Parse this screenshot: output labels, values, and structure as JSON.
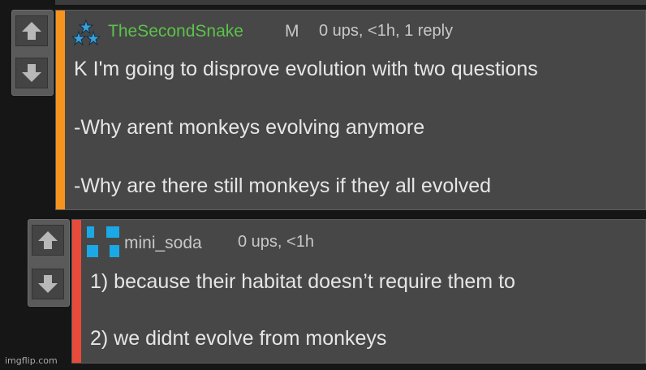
{
  "comments": [
    {
      "username": "TheSecondSnake",
      "badge": "M",
      "meta": "0 ups, <1h, 1 reply",
      "lines": [
        "K I'm going to disprove evolution with two questions",
        "-Why arent monkeys evolving anymore",
        "-Why are there still monkeys if they all evolved"
      ],
      "bar_color": "#f7941d",
      "username_color": "#5cc24a",
      "avatar_icon": "stars-avatar-icon"
    },
    {
      "username": "mini_soda",
      "meta": "0 ups, <1h",
      "lines": [
        "1) because their habitat doesn’t require them to",
        "2) we didnt evolve from monkeys"
      ],
      "bar_color": "#e84b3c",
      "username_color": "#c8c8c8",
      "avatar_icon": "blue-squares-avatar-icon"
    }
  ],
  "watermark": "imgflip.com",
  "colors": {
    "text": "#e6e6e6",
    "meta": "#c8c8c8",
    "background": "#161616",
    "comment_bg": "#474747"
  },
  "icons": {
    "upvote": "arrow-up-icon",
    "downvote": "arrow-down-icon"
  }
}
